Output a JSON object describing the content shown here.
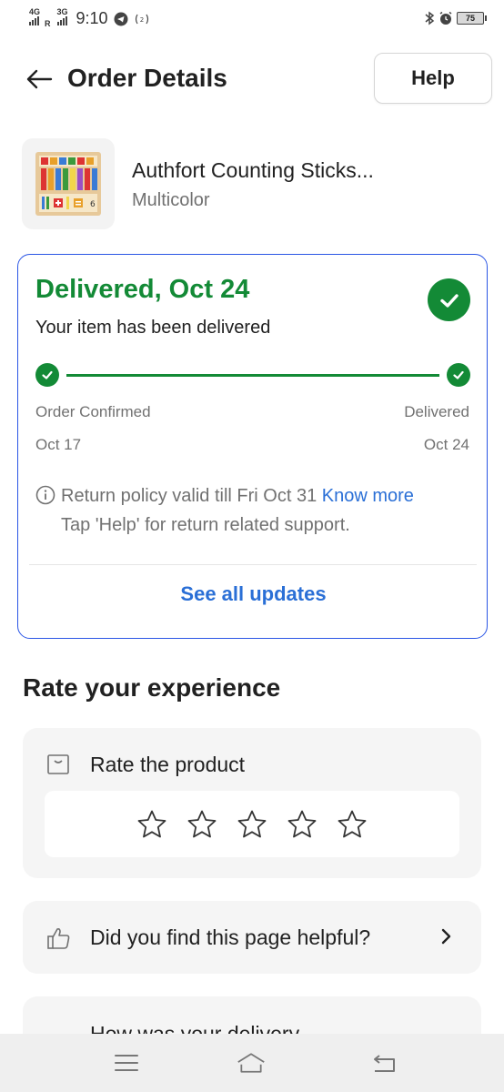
{
  "status_bar": {
    "network_1": "4G",
    "roaming": "R",
    "network_2": "3G",
    "time": "9:10",
    "battery": "75"
  },
  "header": {
    "title": "Order Details",
    "help_label": "Help"
  },
  "product": {
    "name": "Authfort Counting Sticks...",
    "variant": "Multicolor"
  },
  "delivery": {
    "status": "Delivered, Oct 24",
    "message": "Your item has been delivered",
    "steps": [
      {
        "label": "Order Confirmed",
        "date": "Oct 17"
      },
      {
        "label": "Delivered",
        "date": "Oct 24"
      }
    ],
    "policy_text": "Return policy valid till Fri Oct 31",
    "policy_link": "Know more",
    "policy_note": "Tap 'Help' for return related support.",
    "see_all": "See all updates",
    "accent_color": "#138a36",
    "border_color": "#2a55e5",
    "link_color": "#2a6fd6"
  },
  "rating": {
    "section_title": "Rate your experience",
    "product_label": "Rate the product",
    "stars_selected": 0,
    "stars_total": 5,
    "helpful_label": "Did you find this page helpful?",
    "delivery_label": "How was your delivery"
  },
  "icons": {
    "back": "arrow-left-icon",
    "check": "check-icon",
    "info": "info-icon",
    "rate": "box-icon",
    "star": "star-outline-icon",
    "thumb": "thumbs-up-icon",
    "chevron": "chevron-right-icon",
    "nav_menu": "menu-icon",
    "nav_home": "home-icon",
    "nav_back": "return-icon"
  }
}
